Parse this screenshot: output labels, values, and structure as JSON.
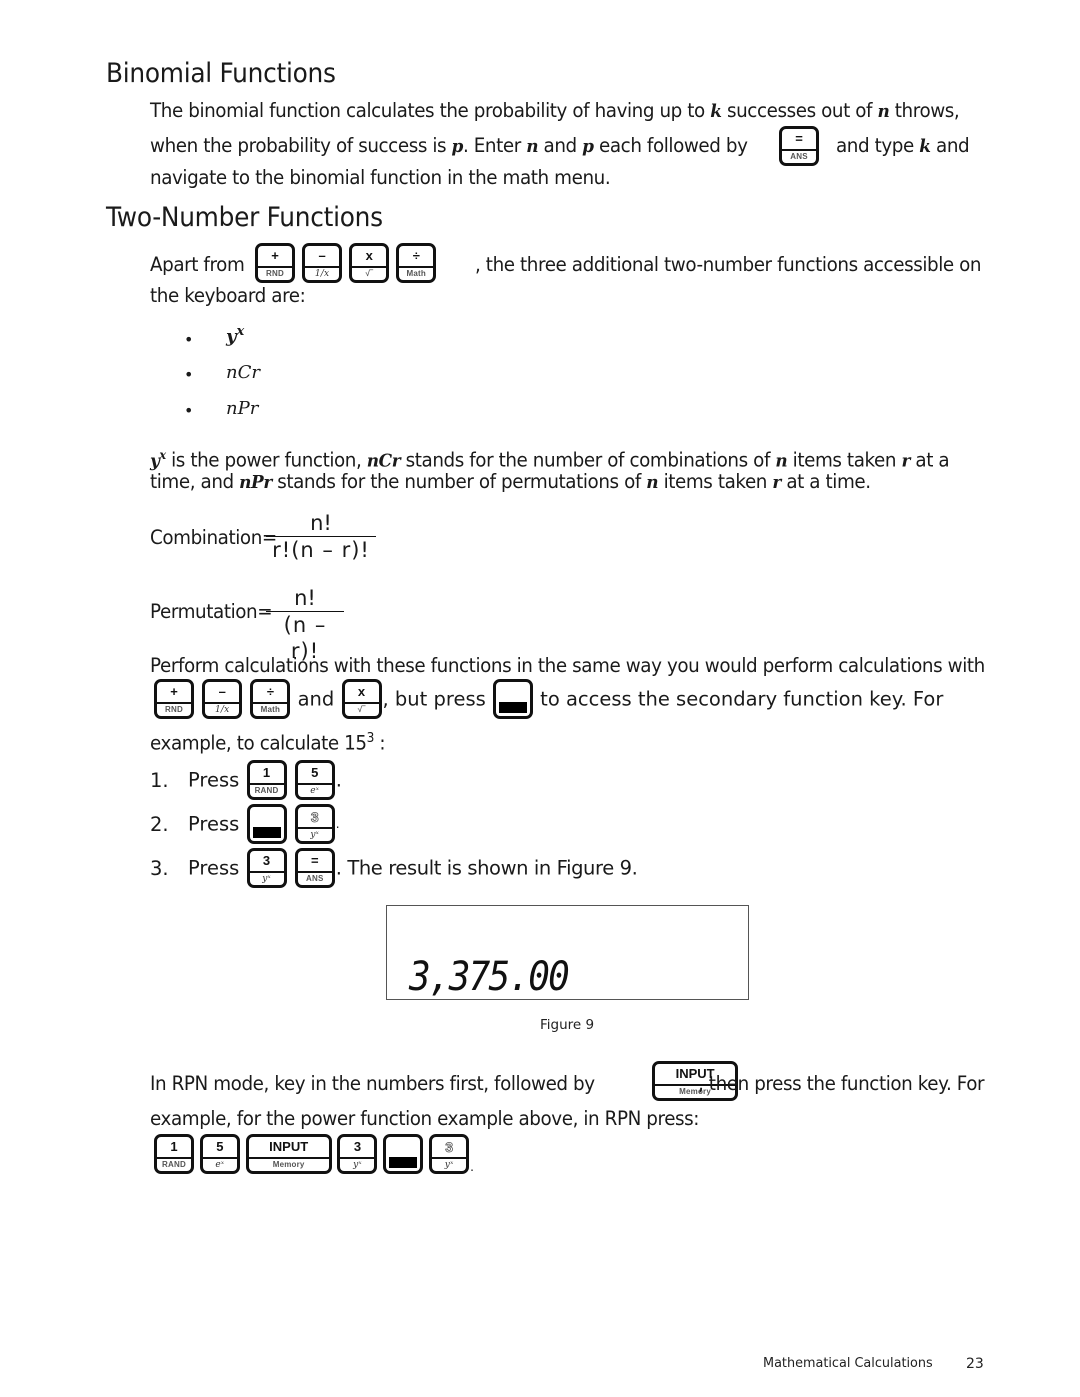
{
  "binomial": {
    "heading": "Binomial Functions",
    "line1_a": "The binomial function calculates the probability of having up to ",
    "var_k": "k",
    "line1_b": " successes out of ",
    "var_n": "n",
    "line1_c": " throws,",
    "line2_a": "when the probability of success is ",
    "var_p": "p",
    "line2_b": ". Enter ",
    "line2_c": " and ",
    "line2_d": " each followed by ",
    "line2_e": " and type ",
    "line2_f": " and",
    "line3": "navigate to the binomial function in the math menu."
  },
  "two_number": {
    "heading": "Two-Number Functions",
    "apart_from": "Apart from ",
    "apart_rest": ", the three additional two-number functions accessible on",
    "line2": "the keyboard are:",
    "bullets": [
      {
        "base": "y",
        "sup": "x"
      },
      {
        "base": "nCr",
        "sup": ""
      },
      {
        "base": "nPr",
        "sup": ""
      }
    ],
    "desc1_a": " is the power function, ",
    "desc1_b": " stands for the number of combinations of ",
    "desc1_c": " items taken ",
    "desc1_d": " at a",
    "desc2_a": "time, and ",
    "desc2_b": " stands for the number of permutations of ",
    "desc2_c": " items taken ",
    "desc2_d": " at a time.",
    "var_r": "r",
    "var_n": "n",
    "var_nCr": "nCr",
    "var_nPr": "nPr",
    "var_y": "y",
    "var_x": "x"
  },
  "formulas": {
    "combination_label": "Combination=",
    "combination_num": "n!",
    "combination_den": "r!(n – r)!",
    "permutation_label": "Permutation=",
    "permutation_num": "n!",
    "permutation_den": "(n – r)!"
  },
  "perform": {
    "line1": "Perform calculations with these functions in the same way you would perform calculations with",
    "and": " and ",
    "but_press": ", but press ",
    "to_access": " to access the secondary function key. For",
    "example": "example, to calculate 15",
    "example_sup": "3",
    "example_end": " :"
  },
  "steps": [
    {
      "num": "1.",
      "label": "Press",
      "after": "."
    },
    {
      "num": "2.",
      "label": "Press",
      "after": "."
    },
    {
      "num": "3.",
      "label": "Press",
      "after": ". The result is shown in Figure 9."
    }
  ],
  "keys": {
    "plus": {
      "top": "+",
      "bottom": "RND"
    },
    "minus": {
      "top": "–",
      "bottom": "1/x"
    },
    "times": {
      "top": "x",
      "bottom": "√‾"
    },
    "divide": {
      "top": "÷",
      "bottom": "Math"
    },
    "equals": {
      "top": "=",
      "bottom": "ANS"
    },
    "one": {
      "top": "1",
      "bottom": "RAND"
    },
    "five": {
      "top": "5",
      "bottom": "eˣ"
    },
    "three": {
      "top": "3",
      "bottom": "yˣ"
    },
    "input": {
      "top": "INPUT",
      "bottom": "Memory"
    }
  },
  "figure": {
    "display_value": "3,375.00",
    "caption": "Figure 9"
  },
  "rpn": {
    "line1_a": "In RPN mode, key in the numbers first, followed by ",
    "line1_b": ", then press the function key. For",
    "line2": "example, for the power function example above, in RPN press:",
    "end": "."
  },
  "footer": {
    "section": "Mathematical Calculations",
    "page": "23"
  }
}
